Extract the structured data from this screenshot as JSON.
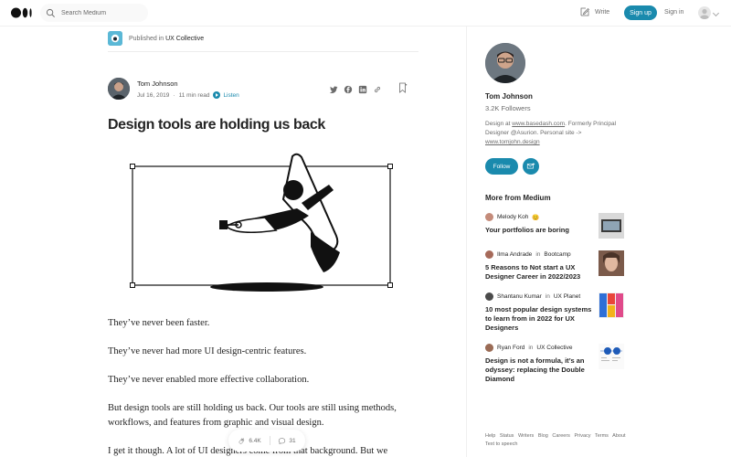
{
  "header": {
    "search_placeholder": "Search Medium",
    "write_label": "Write",
    "signup_label": "Sign up",
    "signin_label": "Sign in"
  },
  "article": {
    "published_prefix": "Published in",
    "publication": "UX Collective",
    "author": "Tom Johnson",
    "date": "Jul 16, 2019",
    "separator": "·",
    "read_time": "11 min read",
    "listen_label": "Listen",
    "title": "Design tools are holding us back",
    "paragraphs": [
      "They’ve never been faster.",
      "They’ve never had more UI design-centric features.",
      "They’ve never enabled more effective collaboration.",
      "But design tools are still holding us back. Our tools are still using methods, workflows, and features from graphic and visual design.",
      "I get it though. A lot of UI designers come from that background. But we"
    ],
    "claps": "6.4K",
    "responses": "31"
  },
  "sidebar": {
    "author_name": "Tom Johnson",
    "followers": "3.2K Followers",
    "bio_prefix": "Design at ",
    "bio_link1": "www.basedash.com",
    "bio_middle": ". Formerly Principal Designer @Asurion. Personal site -> ",
    "bio_link2": "www.tomjohn.design",
    "follow_label": "Follow",
    "more_title": "More from Medium",
    "recommendations": [
      {
        "author": "Melody Koh",
        "emoji": "😊",
        "in": "",
        "publication": "",
        "headline": "Your portfolios are boring"
      },
      {
        "author": "Ilma Andrade",
        "emoji": "",
        "in": "in",
        "publication": "Bootcamp",
        "headline": "5 Reasons to Not start a UX Designer Career in 2022/2023"
      },
      {
        "author": "Shantanu Kumar",
        "emoji": "",
        "in": "in",
        "publication": "UX Planet",
        "headline": "10 most popular design systems to learn from in 2022 for UX Designers"
      },
      {
        "author": "Ryan Ford",
        "emoji": "",
        "in": "in",
        "publication": "UX Collective",
        "headline": "Design is not a formula, it’s an odyssey: replacing the Double Diamond"
      }
    ],
    "footer_links": [
      "Help",
      "Status",
      "Writers",
      "Blog",
      "Careers",
      "Privacy",
      "Terms",
      "About",
      "Text to speech"
    ]
  },
  "colors": {
    "accent": "#1a8aad",
    "text": "#242424",
    "muted": "#6b6b6b"
  }
}
